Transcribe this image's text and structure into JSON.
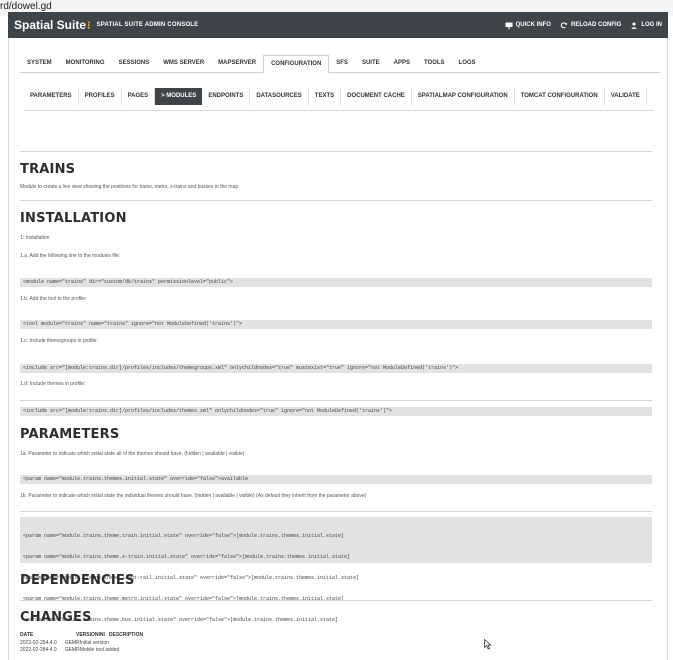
{
  "cut_text": "rd/dowel.gd",
  "header": {
    "brand": "Spatial Suite",
    "console_title": "SPATIAL SUITE ADMIN CONSOLE",
    "actions": [
      {
        "label": "QUICK INFO",
        "icon": "monitor-icon"
      },
      {
        "label": "RELOAD CONFIG",
        "icon": "reload-icon"
      },
      {
        "label": "LOG IN",
        "icon": "user-icon"
      }
    ]
  },
  "nav_main": [
    "SYSTEM",
    "MONITORING",
    "SESSIONS",
    "WMS SERVER",
    "MAPSERVER",
    "CONFIGURATION",
    "SFS",
    "SUITE",
    "APPS",
    "TOOLS",
    "LOGS"
  ],
  "nav_main_active": "CONFIGURATION",
  "nav_sub": [
    "PARAMETERS",
    "PROFILES",
    "PAGES",
    "> MODULES",
    "ENDPOINTS",
    "DATASOURCES",
    "TEXTS",
    "DOCUMENT CACHE",
    "SPATIALMAP CONFIGURATION",
    "TOMCAT CONFIGURATION",
    "VALIDATE"
  ],
  "nav_sub_active": "> MODULES",
  "doc": {
    "title": "TRAINS",
    "description": "Module to create a live view showing the positions for trains, metro, s-trains and busses in the map",
    "installation": {
      "heading": "INSTALLATION",
      "intro": "1: Installation",
      "step_a": "1.a. Add the following line to the modules file:",
      "code_a": "<module name=\"trains\" dir=\"custom/dk/trains\" permissionlevel=\"public\">",
      "step_b": "1.b. Add the tool to the profile:",
      "code_b": "<tool module=\"trains\" name=\"trains\" ignore=\"not ModuleDefined('trains')\">",
      "step_c": "1.c: Include themegroups in profile:",
      "code_c": "<include src=\"[module:trains.dir]/profiles/includes/themegroups.xml\" onlychildnodes=\"true\" mustexist=\"true\" ignore=\"not ModuleDefined('trains')\">",
      "step_d": "1.d: Include themes in profile:",
      "code_d": "<include src=\"[module:trains.dir]/profiles/includes/themes.xml\" onlychildnodes=\"true\" ignore=\"not ModuleDefined('trains')\">"
    },
    "parameters": {
      "heading": "PARAMETERS",
      "p1": "1a. Parameter to indicate which initial state all of the themes should have. (hidden | available | visible)",
      "code1": "<param name=\"module.trains.themes.initial.state\" override=\"false\">available",
      "p2": "1b. Parameter to indicate which initial state the individual themes should have. (hidden | available | visible) (As default they inherit from the parameter above)",
      "code2": [
        "<param name=\"module.trains.theme.train.initial.state\" override=\"false\">[module.trains.themes.initial.state]",
        "<param name=\"module.trains.theme.s-train.initial.state\" override=\"false\">[module.trains.themes.initial.state]",
        "<param name=\"module.trains.theme.light-rail.initial.state\" override=\"false\">[module.trains.themes.initial.state]",
        "<param name=\"module.trains.theme.metro.initial.state\" override=\"false\">[module.trains.themes.initial.state]",
        "<param name=\"module.trains.theme.bus.initial.state\" override=\"false\">[module.trains.themes.initial.state]"
      ]
    },
    "dependencies": {
      "heading": "DEPENDENCIES"
    },
    "changes": {
      "heading": "CHANGES",
      "columns": [
        "DATE",
        "VERSION",
        "INI",
        "DESCRIPTION"
      ],
      "rows": [
        {
          "date": "2022-02-25",
          "version": "4.4.0",
          "ini": "GEMR",
          "description": "Initial version"
        },
        {
          "date": "2022-02-28",
          "version": "4.4.0",
          "ini": "GEMR",
          "description": "Mobile tool added"
        }
      ]
    }
  }
}
